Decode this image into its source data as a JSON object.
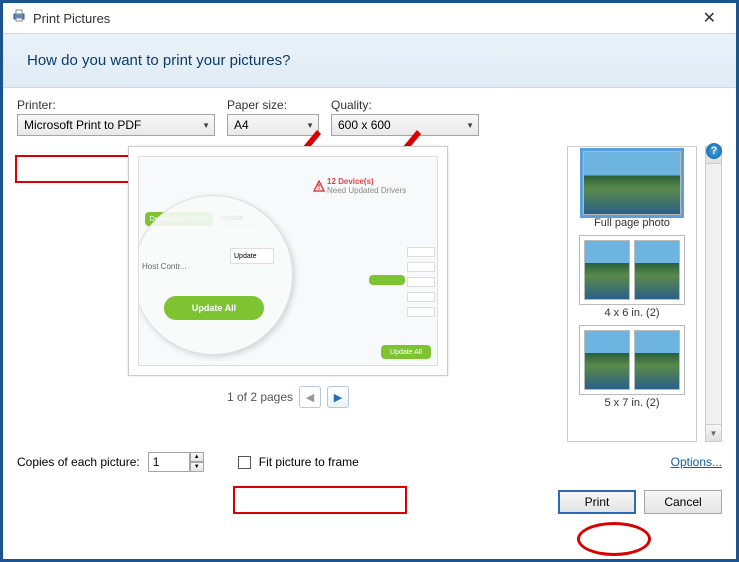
{
  "window": {
    "title": "Print Pictures",
    "heading": "How do you want to print your pictures?"
  },
  "controls": {
    "printer_label": "Printer:",
    "printer_value": "Microsoft Print to PDF",
    "papersize_label": "Paper size:",
    "papersize_value": "A4",
    "quality_label": "Quality:",
    "quality_value": "600 x 600"
  },
  "pager": {
    "text": "1 of 2 pages"
  },
  "layouts": {
    "full": "Full page photo",
    "fourbysix": "4 x 6 in. (2)",
    "fivebyseven": "5 x 7 in. (2)"
  },
  "bottom": {
    "copies_label": "Copies of each picture:",
    "copies_value": "1",
    "fit_label": "Fit picture to frame",
    "options": "Options..."
  },
  "footer": {
    "print": "Print",
    "cancel": "Cancel"
  },
  "preview_mock": {
    "downloaded": "Downloaded 100%",
    "update": "Update",
    "updateall": "Update All",
    "devices_bold": "12 Device(s)",
    "devices_sub": "Need Updated Drivers",
    "host": "Host Contr..."
  },
  "icons": {
    "printer": "printer-icon",
    "chevron": "chevron-down-icon",
    "help": "?"
  }
}
